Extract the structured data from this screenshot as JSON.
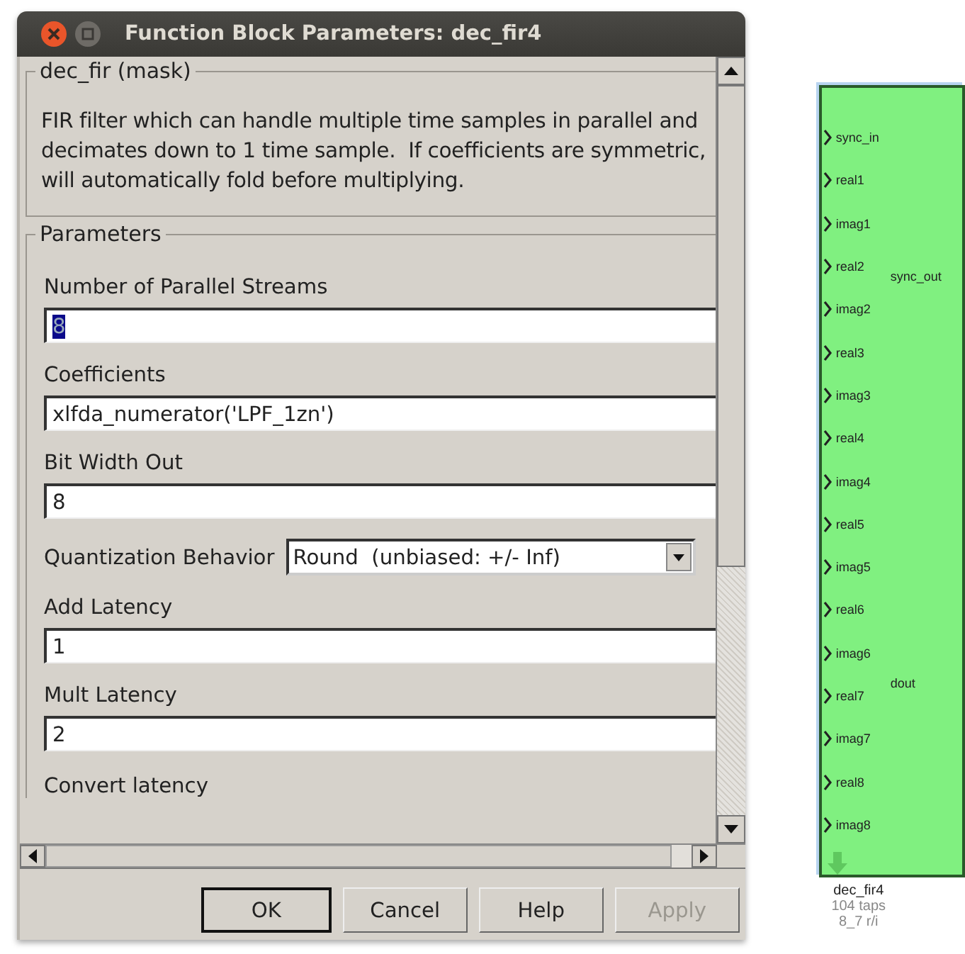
{
  "window": {
    "title": "Function Block Parameters: dec_fir4"
  },
  "mask": {
    "title": "dec_fir (mask)",
    "description": "FIR filter which can handle multiple time samples in parallel and decimates down to 1 time sample.  If coefficients are symmetric, will automatically fold before multiplying."
  },
  "parameters": {
    "title": "Parameters",
    "fields": [
      {
        "kind": "text",
        "label": "Number of Parallel Streams",
        "value": "8",
        "selected": true
      },
      {
        "kind": "text",
        "label": "Coefficients",
        "value": "xlfda_numerator('LPF_1zn')",
        "selected": false
      },
      {
        "kind": "text",
        "label": "Bit Width Out",
        "value": "8",
        "selected": false
      },
      {
        "kind": "dropdown",
        "label": "Quantization Behavior",
        "value": "Round  (unbiased: +/- Inf)"
      },
      {
        "kind": "text",
        "label": "Add Latency",
        "value": "1",
        "selected": false
      },
      {
        "kind": "text",
        "label": "Mult Latency",
        "value": "2",
        "selected": false
      },
      {
        "kind": "label",
        "label": "Convert latency"
      }
    ]
  },
  "buttons": [
    {
      "label": "OK",
      "default": true,
      "disabled": false
    },
    {
      "label": "Cancel",
      "default": false,
      "disabled": false
    },
    {
      "label": "Help",
      "default": false,
      "disabled": false
    },
    {
      "label": "Apply",
      "default": false,
      "disabled": true
    }
  ],
  "block": {
    "inputs": [
      "sync_in",
      "real1",
      "imag1",
      "real2",
      "imag2",
      "real3",
      "imag3",
      "real4",
      "imag4",
      "real5",
      "imag5",
      "real6",
      "imag6",
      "real7",
      "imag7",
      "real8",
      "imag8"
    ],
    "outputs": [
      "sync_out",
      "dout"
    ],
    "name": "dec_fir4",
    "annotations": [
      "104 taps",
      "8_7 r/i"
    ]
  }
}
